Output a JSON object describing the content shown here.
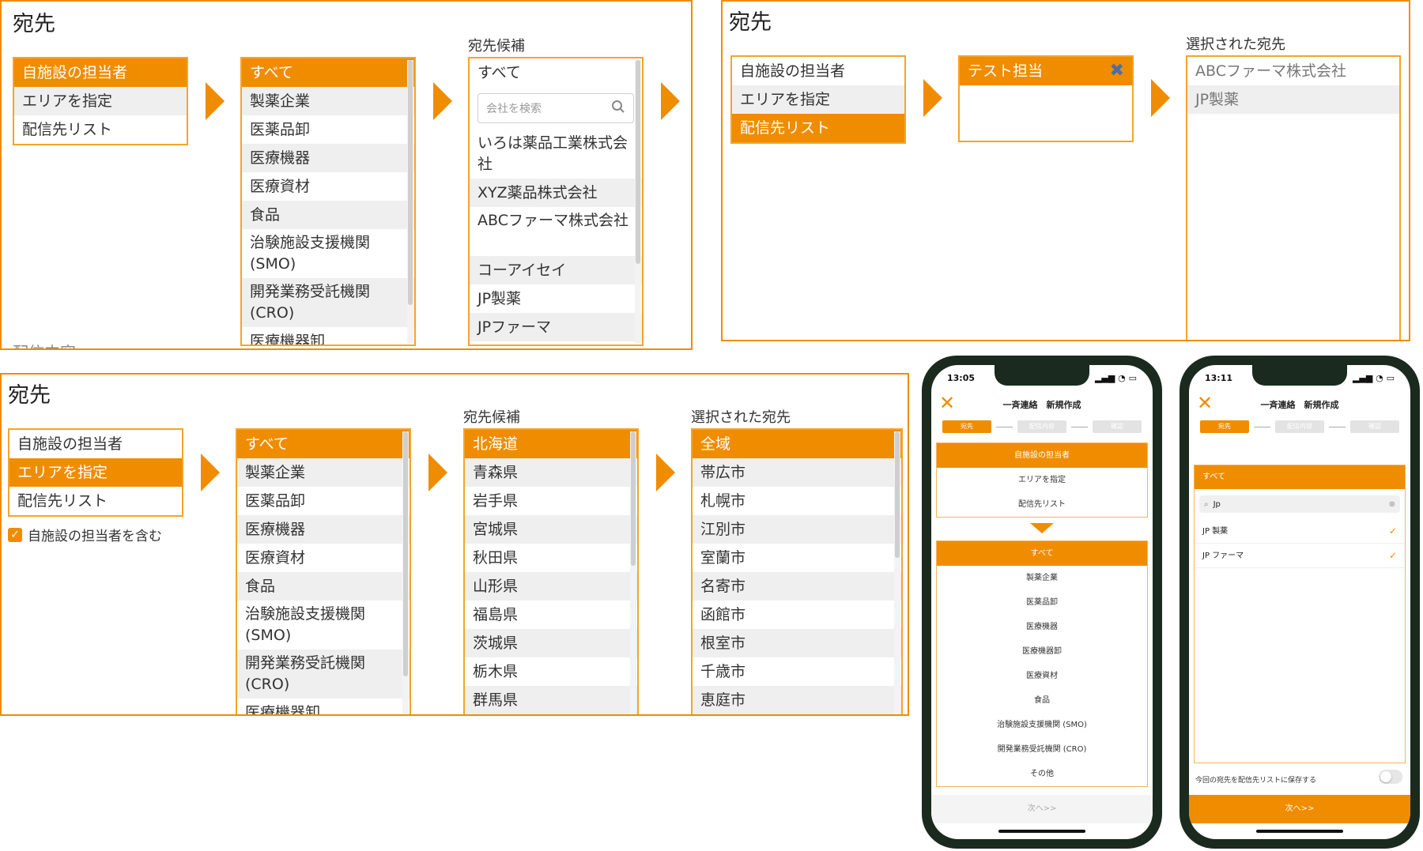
{
  "panel1": {
    "title": "宛先",
    "categories": [
      "自施設の担当者",
      "エリアを指定",
      "配信先リスト"
    ],
    "types": [
      "すべて",
      "製薬企業",
      "医薬品卸",
      "医療機器",
      "医療資材",
      "食品",
      "治験施設支援機関(SMO)",
      "開発業務受託機関(CRO)",
      "医療機器卸"
    ],
    "candidates_title": "宛先候補",
    "candidates_all": "すべて",
    "search_placeholder": "会社を検索",
    "candidates": [
      "いろは薬品工業株式会社",
      "XYZ薬品株式会社",
      "ABCファーマ株式会社",
      "コーアイセイ",
      "JP製薬",
      "JPファーマ"
    ],
    "footer_cut": "配信内容"
  },
  "panel2": {
    "title": "宛先",
    "categories": [
      "自施設の担当者",
      "エリアを指定",
      "配信先リスト"
    ],
    "list_name": "テスト担当",
    "selected_title": "選択された宛先",
    "selected": [
      "ABCファーマ株式会社",
      "JP製薬"
    ]
  },
  "panel3": {
    "title": "宛先",
    "categories": [
      "自施設の担当者",
      "エリアを指定",
      "配信先リスト"
    ],
    "include_label": "自施設の担当者を含む",
    "types": [
      "すべて",
      "製薬企業",
      "医薬品卸",
      "医療機器",
      "医療資材",
      "食品",
      "治験施設支援機関(SMO)",
      "開発業務受託機関(CRO)",
      "医療機器卸"
    ],
    "candidates_title": "宛先候補",
    "prefectures": [
      "北海道",
      "青森県",
      "岩手県",
      "宮城県",
      "秋田県",
      "山形県",
      "福島県",
      "茨城県",
      "栃木県",
      "群馬県"
    ],
    "selected_title": "選択された宛先",
    "cities": [
      "全域",
      "帯広市",
      "札幌市",
      "江別市",
      "室蘭市",
      "名寄市",
      "函館市",
      "根室市",
      "千歳市",
      "恵庭市"
    ]
  },
  "phone1": {
    "time": "13:05",
    "header": "一斉連絡　新規作成",
    "steps": [
      "宛先",
      "配信内容",
      "確認"
    ],
    "categories": [
      "自施設の担当者",
      "エリアを指定",
      "配信先リスト"
    ],
    "types": [
      "すべて",
      "製薬企業",
      "医薬品卸",
      "医療機器",
      "医療機器卸",
      "医療資材",
      "食品",
      "治験施設支援機関 (SMO)",
      "開発業務受託機関 (CRO)",
      "その他"
    ],
    "next": "次へ>>"
  },
  "phone2": {
    "time": "13:11",
    "header": "一斉連絡　新規作成",
    "steps": [
      "宛先",
      "配信内容",
      "確認"
    ],
    "all_label": "すべて",
    "search_value": "Jp",
    "results": [
      "JP 製薬",
      "JP ファーマ"
    ],
    "save_label": "今回の宛先を配信先リストに保存する",
    "next": "次へ>>"
  }
}
